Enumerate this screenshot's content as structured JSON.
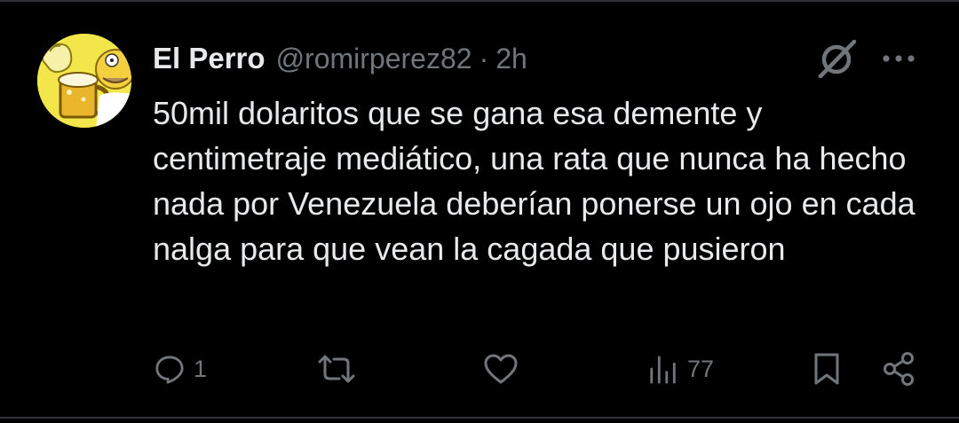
{
  "tweet": {
    "author_name": "El Perro",
    "handle": "@romirperez82",
    "separator": "·",
    "time": "2h",
    "text": "50mil dolaritos que se gana esa demente y centimetraje mediático, una rata que nunca ha hecho nada por Venezuela deberían ponerse un ojo en cada nalga para que vean la cagada que pusieron",
    "avatar_icon": "cartoon-character-with-beer-mug",
    "reply_count": "1",
    "view_count": "77"
  },
  "colors": {
    "background": "#000000",
    "text": "#e7e9ea",
    "secondary": "#71767b",
    "border": "#2f3336",
    "avatar_bg": "#f2e64a"
  }
}
